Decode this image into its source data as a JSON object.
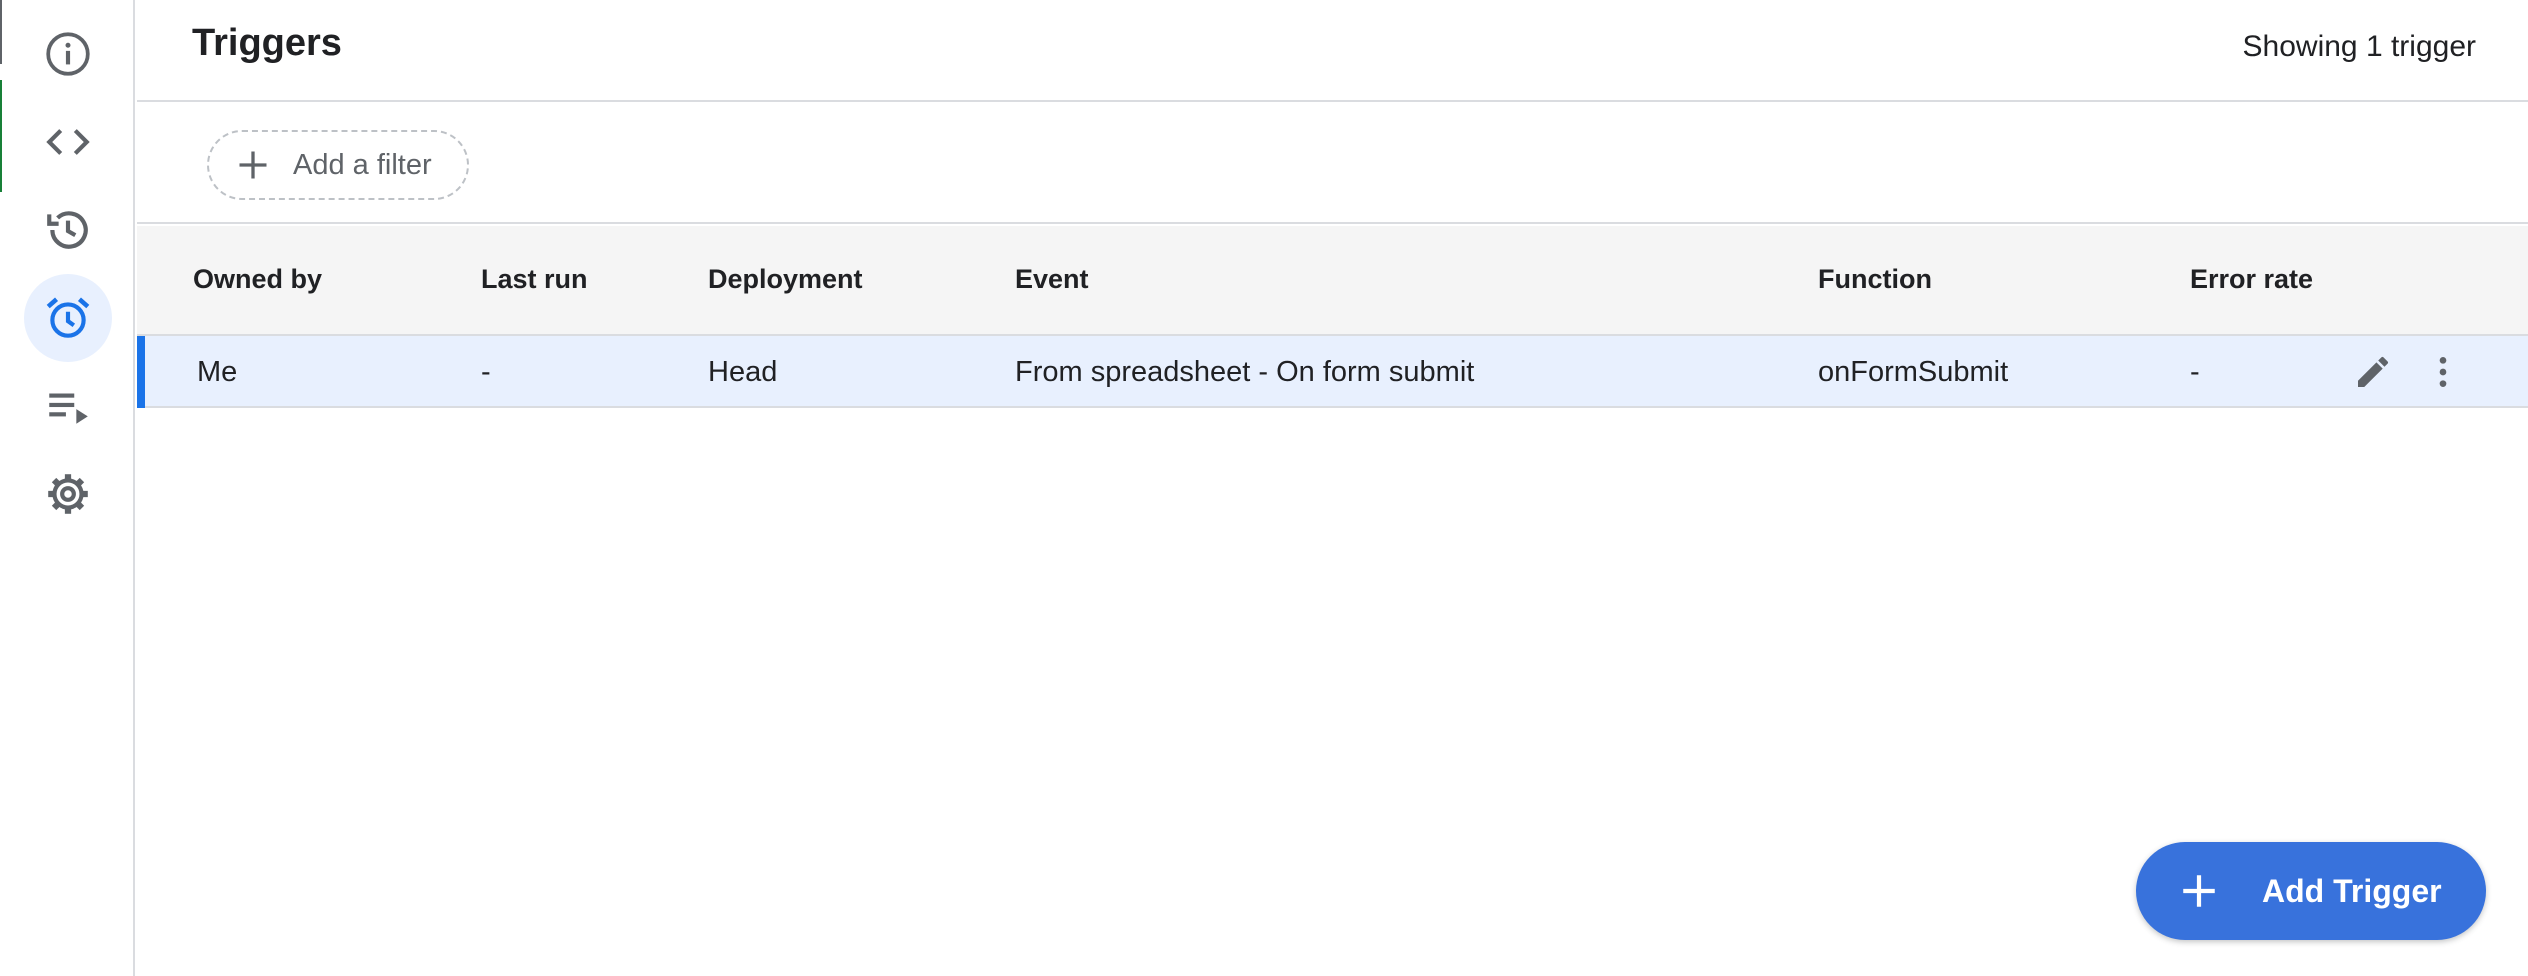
{
  "header": {
    "title": "Triggers",
    "count_text": "Showing 1 trigger"
  },
  "rail": {
    "items": [
      {
        "icon": "info-icon",
        "active": false
      },
      {
        "icon": "code-icon",
        "active": false
      },
      {
        "icon": "history-icon",
        "active": false
      },
      {
        "icon": "alarm-clock-icon",
        "active": true
      },
      {
        "icon": "executions-icon",
        "active": false
      },
      {
        "icon": "gear-icon",
        "active": false
      }
    ],
    "active_color": "#1a73e8"
  },
  "filter": {
    "add_filter_label": "Add a filter"
  },
  "table": {
    "columns": [
      "Owned by",
      "Last run",
      "Deployment",
      "Event",
      "Function",
      "Error rate"
    ],
    "rows": [
      {
        "owned_by": "Me",
        "last_run": "-",
        "deployment": "Head",
        "event": "From spreadsheet - On form submit",
        "function": "onFormSubmit",
        "error_rate": "-"
      }
    ]
  },
  "fab": {
    "label": "Add Trigger",
    "color": "#3872dc"
  }
}
